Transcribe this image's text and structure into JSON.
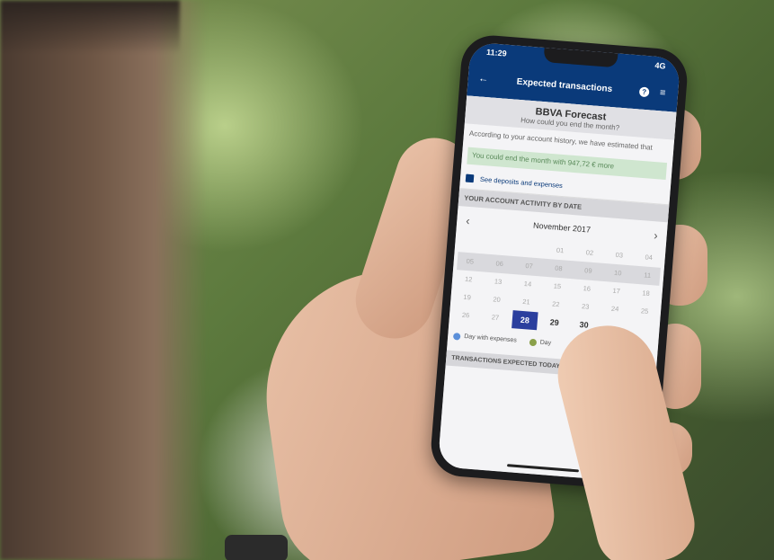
{
  "status_bar": {
    "time": "11:29",
    "signal": "4G"
  },
  "app_bar": {
    "back_icon": "back-arrow-icon",
    "title": "Expected transactions",
    "help_icon": "help-circle-icon",
    "menu_icon": "filter-menu-icon"
  },
  "forecast": {
    "title": "BBVA Forecast",
    "subtitle": "How could you end the month?",
    "body": "According to your account history, we have estimated that",
    "banner": "You could end the month with 947,72 € more"
  },
  "deposits_link": {
    "label": "See deposits and expenses"
  },
  "activity": {
    "header": "YOUR ACCOUNT ACTIVITY BY DATE",
    "month": "November 2017",
    "prev_icon": "chevron-left-icon",
    "next_icon": "chevron-right-icon"
  },
  "calendar": {
    "weeks": [
      [
        "",
        "",
        "",
        "",
        "01",
        "02",
        "03",
        "04"
      ],
      [
        "05",
        "06",
        "07",
        "08",
        "09",
        "10",
        "11"
      ],
      [
        "12",
        "13",
        "14",
        "15",
        "16",
        "17",
        "18"
      ],
      [
        "19",
        "20",
        "21",
        "22",
        "23",
        "24",
        "25"
      ],
      [
        "26",
        "27",
        "28",
        "29",
        "30",
        "",
        ""
      ]
    ],
    "selected": "28"
  },
  "legend": {
    "expenses": "Day with expenses",
    "other": "Day"
  },
  "transactions_header": "TRANSACTIONS EXPECTED TODAY",
  "colors": {
    "app_bar": "#0a3a7a",
    "selected_day": "#2b3f9e",
    "banner_bg": "#cfe6cf",
    "expense_dot": "#5b8fd9",
    "other_dot": "#8aa04a"
  }
}
